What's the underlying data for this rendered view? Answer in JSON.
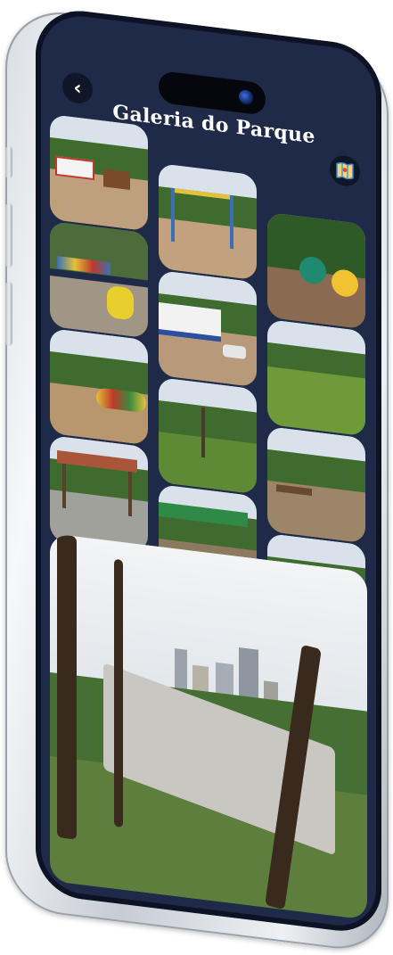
{
  "header": {
    "title": "Galeria do Parque",
    "back_icon": "chevron-left-icon",
    "map_icon": "map-icon"
  },
  "colors": {
    "screen_bg": "#1e2a47",
    "button_bg": "#0f1628",
    "title_text": "#ffffff"
  },
  "gallery": {
    "photos": [
      {
        "id": "playground-sign"
      },
      {
        "id": "swings"
      },
      {
        "id": "info-signs"
      },
      {
        "id": "tire-planters"
      },
      {
        "id": "building"
      },
      {
        "id": "lake"
      },
      {
        "id": "caterpillar-tunnel"
      },
      {
        "id": "lawn-tree"
      },
      {
        "id": "picnic-area"
      },
      {
        "id": "gazebo"
      },
      {
        "id": "green-shelter"
      },
      {
        "id": "path-trees"
      },
      {
        "id": "skatepark-city-view"
      }
    ]
  }
}
